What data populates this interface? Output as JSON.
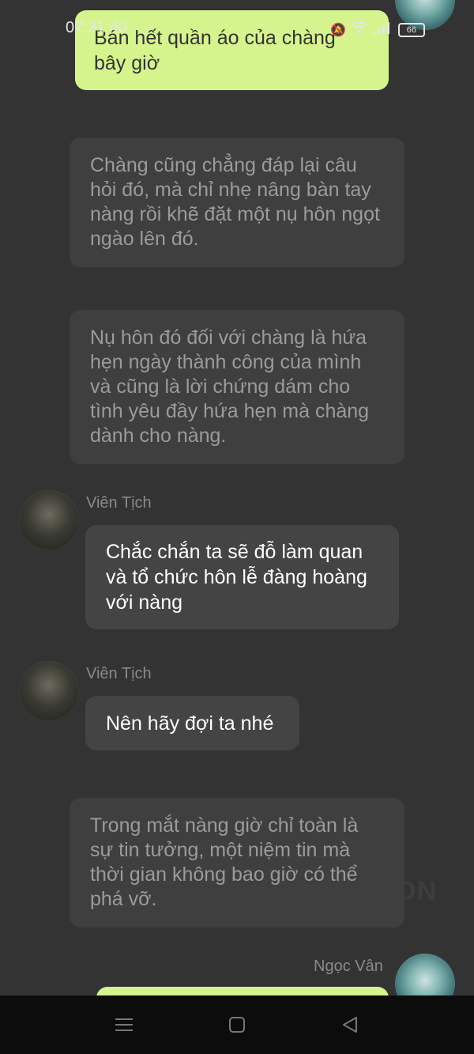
{
  "status": {
    "time": "07:31:40",
    "battery": "66"
  },
  "messages": {
    "m1": "Bán hết quần áo của chàng bây giờ",
    "n1": "Chàng cũng chẳng đáp lại câu hỏi đó, mà chỉ nhẹ nâng bàn tay nàng rồi khẽ đặt một nụ hôn ngọt ngào lên đó.",
    "n2": "Nụ hôn đó đối với chàng là hứa hẹn ngày thành công của mình và cũng là lời chứng dám cho tình yêu đầy hứa hẹn mà chàng dành cho nàng.",
    "o1_sender": "Viên Tịch",
    "o1": "Chắc chắn ta sẽ đỗ làm quan và tổ chức hôn lễ đàng hoàng với nàng",
    "o2_sender": "Viên Tịch",
    "o2": "Nên hãy đợi ta nhé",
    "n3": "Trong mắt nàng giờ chỉ toàn là sự tin tưởng, một niệm tin mà thời gian không bao giờ có thể phá vỡ.",
    "me_sender": "Ngọc Vân"
  },
  "watermark": "ON",
  "colors": {
    "my_bubble": "#d5f48e",
    "narration_bubble": "#3f3f3f",
    "other_bubble": "#444444",
    "background": "#333333"
  }
}
